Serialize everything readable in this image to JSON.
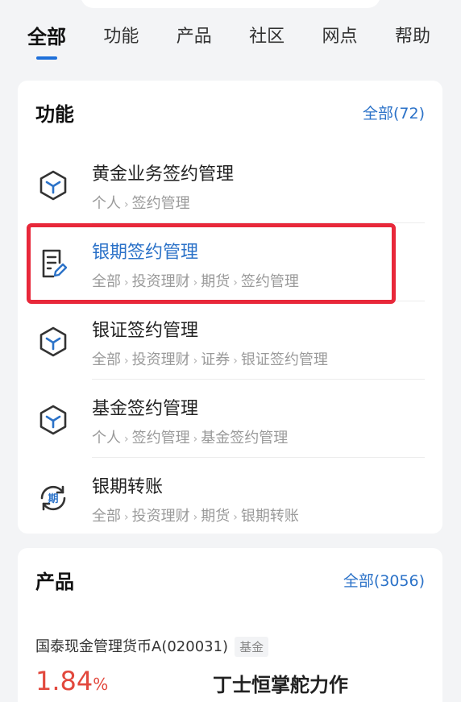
{
  "tabs": [
    {
      "label": "全部"
    },
    {
      "label": "功能"
    },
    {
      "label": "产品"
    },
    {
      "label": "社区"
    },
    {
      "label": "网点"
    },
    {
      "label": "帮助"
    }
  ],
  "functions": {
    "title": "功能",
    "more": "全部(72)",
    "items": [
      {
        "title": "黄金业务签约管理",
        "path": [
          "个人",
          "签约管理"
        ],
        "icon": "cube-icon"
      },
      {
        "title": "银期签约管理",
        "path": [
          "全部",
          "投资理财",
          "期货",
          "签约管理"
        ],
        "icon": "document-edit-icon"
      },
      {
        "title": "银证签约管理",
        "path": [
          "全部",
          "投资理财",
          "证券",
          "银证签约管理"
        ],
        "icon": "cube-icon"
      },
      {
        "title": "基金签约管理",
        "path": [
          "个人",
          "签约管理",
          "基金签约管理"
        ],
        "icon": "cube-icon"
      },
      {
        "title": "银期转账",
        "path": [
          "全部",
          "投资理财",
          "期货",
          "银期转账"
        ],
        "icon": "futures-transfer-icon",
        "icon_text": "期"
      }
    ]
  },
  "products": {
    "title": "产品",
    "more": "全部(3056)",
    "first": {
      "name": "国泰现金管理货币A(020031)",
      "tag": "基金",
      "rate": "1.84",
      "rate_unit": "%",
      "slogan": "丁士恒掌舵力作"
    }
  },
  "colors": {
    "accent": "#2b72c8",
    "highlight_box": "#e8283a",
    "rate": "#e2483d"
  }
}
